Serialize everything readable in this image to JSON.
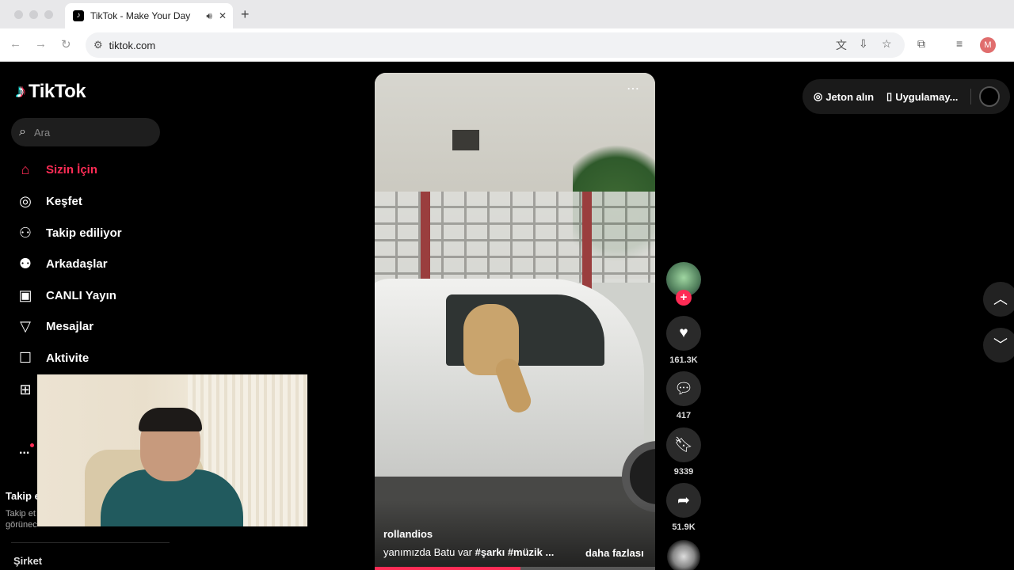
{
  "browser": {
    "tab_title": "TikTok - Make Your Day",
    "url": "tiktok.com",
    "profile_initial": "M"
  },
  "app": {
    "logo_text": "TikTok",
    "search_placeholder": "Ara"
  },
  "sidebar": {
    "items": [
      {
        "label": "Sizin İçin",
        "icon": "home-icon",
        "active": true
      },
      {
        "label": "Keşfet",
        "icon": "compass-icon",
        "active": false
      },
      {
        "label": "Takip ediliyor",
        "icon": "following-icon",
        "active": false
      },
      {
        "label": "Arkadaşlar",
        "icon": "friends-icon",
        "active": false
      },
      {
        "label": "CANLI Yayın",
        "icon": "live-icon",
        "active": false
      },
      {
        "label": "Mesajlar",
        "icon": "send-icon",
        "active": false
      },
      {
        "label": "Aktivite",
        "icon": "activity-icon",
        "active": false
      }
    ],
    "more_label": "...",
    "following_title": "Takip e",
    "following_desc": "Takip et görünec",
    "company_label": "Şirket"
  },
  "video": {
    "author": "rollandios",
    "caption_text": "yanımızda Batu var ",
    "caption_tags": "#şarkı  #müzik  ...",
    "see_more": "daha fazlası",
    "progress": 0.52
  },
  "actions": {
    "likes": "161.3K",
    "comments": "417",
    "saves": "9339",
    "shares": "51.9K"
  },
  "topbar": {
    "coins_label": "Jeton alın",
    "app_label": "Uygulamay..."
  },
  "colors": {
    "accent": "#fe2c55",
    "background": "#000000"
  }
}
